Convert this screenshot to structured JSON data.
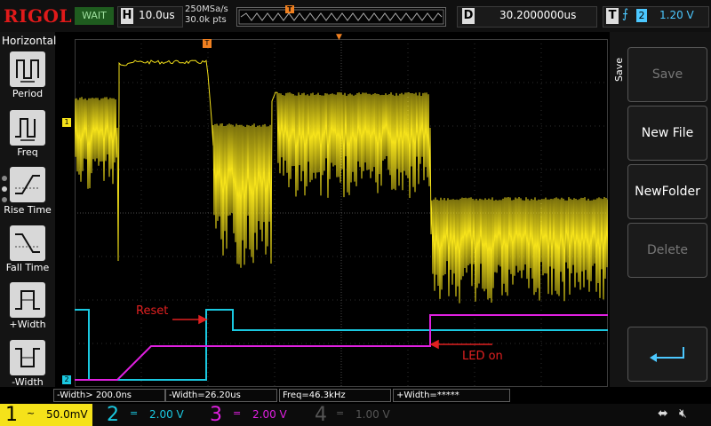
{
  "topbar": {
    "brand": "RIGOL",
    "run_state": "WAIT",
    "horizontal": {
      "label": "H",
      "timebase": "10.0us"
    },
    "sample_rate": "250MSa/s",
    "memory_depth": "30.0k pts",
    "trigger_marker": "T",
    "delay": {
      "label": "D",
      "value": "30.2000000us"
    },
    "trigger": {
      "label": "T",
      "edge_icon": "rising-edge-icon",
      "source": "2",
      "level": "1.20 V"
    }
  },
  "left_panel": {
    "title": "Horizontal",
    "items": [
      {
        "label": "Period",
        "icon": "period-icon"
      },
      {
        "label": "Freq",
        "icon": "frequency-icon"
      },
      {
        "label": "Rise Time",
        "icon": "rise-time-icon"
      },
      {
        "label": "Fall Time",
        "icon": "fall-time-icon"
      },
      {
        "label": "+Width",
        "icon": "positive-width-icon"
      },
      {
        "label": "-Width",
        "icon": "negative-width-icon"
      }
    ]
  },
  "right_panel": {
    "title": "Save",
    "buttons": [
      {
        "label": "Save",
        "enabled": false
      },
      {
        "label": "New File",
        "enabled": true
      },
      {
        "label": "NewFolder",
        "enabled": true
      },
      {
        "label": "Delete",
        "enabled": false
      }
    ],
    "back_icon": "return-arrow-icon"
  },
  "annotations": {
    "reset": "Reset",
    "led_on": "LED on"
  },
  "markers": {
    "ch1": "1",
    "ch2": "2",
    "trigger_level": "T",
    "trigger_pos": "T"
  },
  "measurements": [
    "-Width> 200.0ns",
    "-Width=26.20us",
    "Freq=46.3kHz",
    "+Width=*****"
  ],
  "channels": [
    {
      "num": "1",
      "coupling": "~",
      "scale": "50.0mV",
      "color": "#f5e21a"
    },
    {
      "num": "2",
      "coupling": "=",
      "scale": "2.00 V",
      "color": "#1ac8e0"
    },
    {
      "num": "3",
      "coupling": "=",
      "scale": "2.00 V",
      "color": "#e020e0"
    },
    {
      "num": "4",
      "coupling": "=",
      "scale": "1.00 V",
      "color": "#555555"
    }
  ],
  "status_icons": [
    "usb-icon",
    "speaker-muted-icon"
  ],
  "colors": {
    "ch1": "#f5e21a",
    "ch2": "#1ac8e0",
    "ch3": "#e020e0",
    "trigger": "#f08020",
    "annotation": "#e02020"
  }
}
